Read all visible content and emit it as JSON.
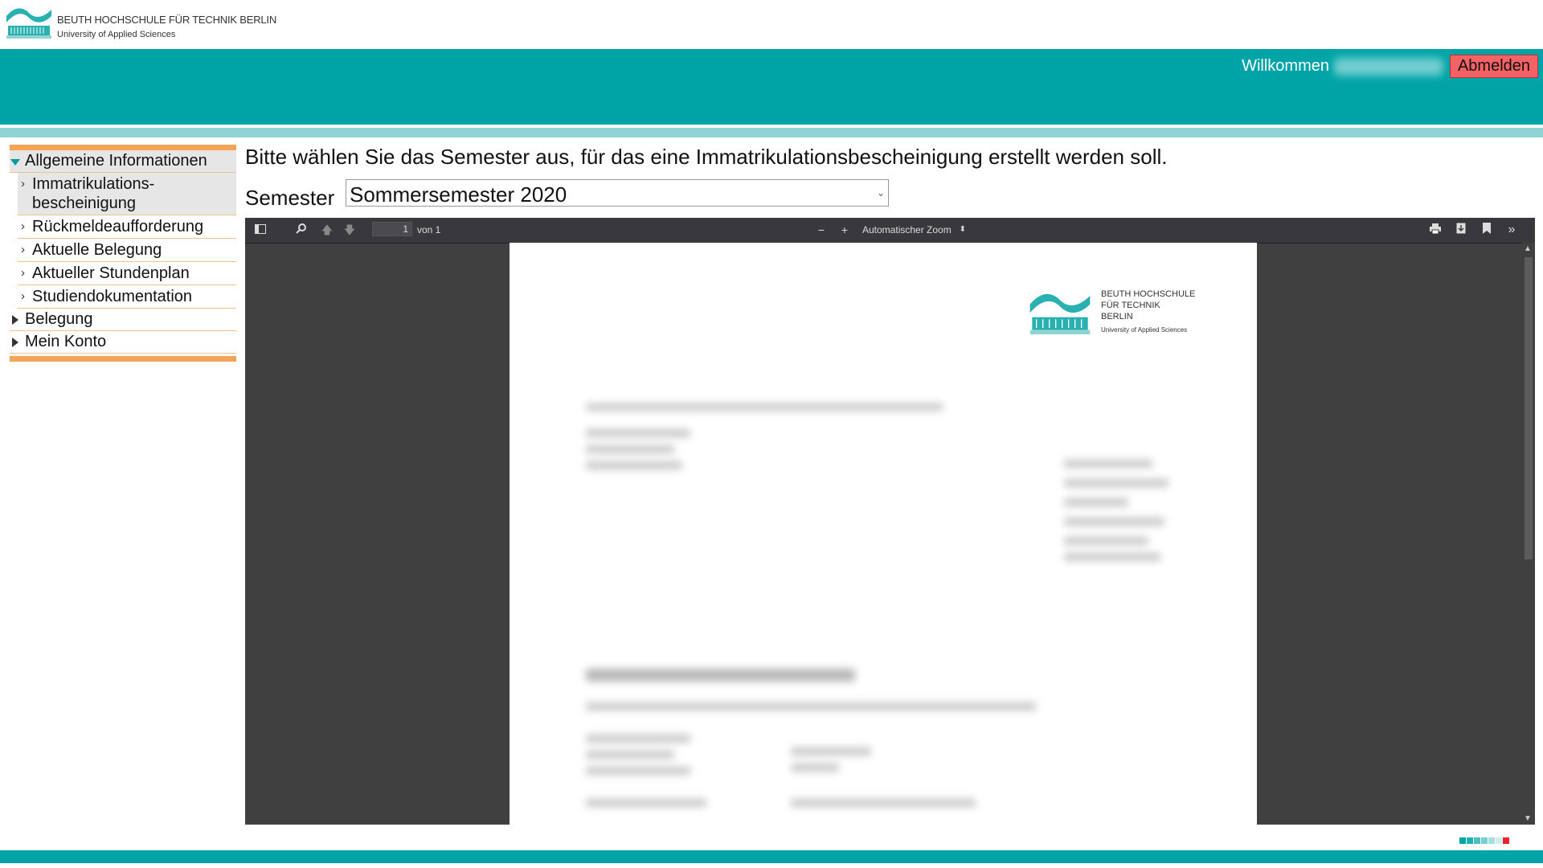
{
  "header": {
    "logo_line1": "BEUTH HOCHSCHULE FÜR TECHNIK BERLIN",
    "logo_line2": "University of Applied Sciences",
    "welcome": "Willkommen",
    "logout": "Abmelden"
  },
  "sidebar": {
    "sections": [
      {
        "label": "Allgemeine Informationen",
        "expanded": true,
        "items": [
          "Immatrikulations- bescheinigung",
          "Rückmeldeaufforderung",
          "Aktuelle Belegung",
          "Aktueller Stundenplan",
          "Studiendokumentation"
        ]
      },
      {
        "label": "Belegung",
        "expanded": false
      },
      {
        "label": "Mein Konto",
        "expanded": false
      }
    ]
  },
  "main": {
    "prompt": "Bitte wählen Sie das Semester aus, für das eine Immatrikulationsbescheinigung erstellt werden soll.",
    "semester_label": "Semester",
    "semester_value": "Sommersemester 2020"
  },
  "viewer": {
    "page_number": "1",
    "page_of": "von 1",
    "zoom": "Automatischer Zoom",
    "doc_logo_line1": "BEUTH HOCHSCHULE",
    "doc_logo_line2": "FÜR TECHNIK",
    "doc_logo_line3": "BERLIN",
    "doc_logo_sub": "University of Applied Sciences"
  },
  "colors": {
    "teal": "#00a4a7",
    "light_teal": "#8fd3d2",
    "orange": "#f5a357",
    "logout_red": "#f46266",
    "viewer_bg": "#404040"
  }
}
